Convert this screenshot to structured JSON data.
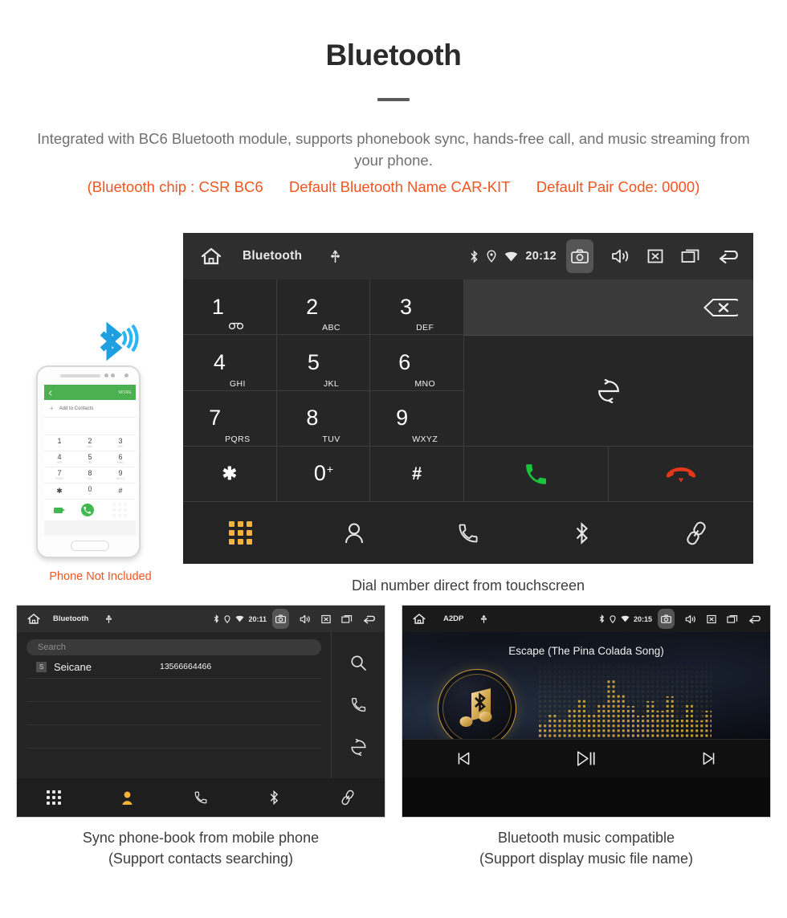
{
  "header": {
    "title": "Bluetooth",
    "description": "Integrated with BC6 Bluetooth module, supports phonebook sync, hands-free call, and music streaming from your phone.",
    "spec_chip": "(Bluetooth chip : CSR BC6",
    "spec_name": "Default Bluetooth Name CAR-KIT",
    "spec_pair": "Default Pair Code: 0000)",
    "accent_color": "#f4541f",
    "text_color": "#707070"
  },
  "phone_mockup": {
    "topbar_more": "MORE",
    "add_to_contacts": "Add to Contacts",
    "plus": "+",
    "keys": [
      {
        "num": "1",
        "sub": "∞"
      },
      {
        "num": "2",
        "sub": "ABC"
      },
      {
        "num": "3",
        "sub": "DEF"
      },
      {
        "num": "4",
        "sub": "GHI"
      },
      {
        "num": "5",
        "sub": "JKL"
      },
      {
        "num": "6",
        "sub": "MNO"
      },
      {
        "num": "7",
        "sub": "PQRS"
      },
      {
        "num": "8",
        "sub": "TUV"
      },
      {
        "num": "9",
        "sub": "WXYZ"
      },
      {
        "num": "✱",
        "sub": ""
      },
      {
        "num": "0",
        "sub": "+"
      },
      {
        "num": "#",
        "sub": ""
      }
    ],
    "not_included_note": "Phone Not Included",
    "note_color": "#f4541f",
    "bluetooth_logo_color": "#1e9fe0"
  },
  "dialer": {
    "statusbar": {
      "home_icon": "home-icon",
      "title": "Bluetooth",
      "usb_icon": "usb-icon",
      "bluetooth_icon": "bluetooth-icon",
      "location_icon": "location-icon",
      "wifi_icon": "wifi-icon",
      "time": "20:12",
      "camera_icon": "camera-icon",
      "volume_icon": "volume-icon",
      "mute_icon": "mute-box-icon",
      "recents_icon": "recents-icon",
      "back_icon": "back-icon"
    },
    "keys": [
      {
        "num": "1",
        "sub": "voicemail"
      },
      {
        "num": "2",
        "sub": "ABC"
      },
      {
        "num": "3",
        "sub": "DEF"
      },
      {
        "num": "4",
        "sub": "GHI"
      },
      {
        "num": "5",
        "sub": "JKL"
      },
      {
        "num": "6",
        "sub": "MNO"
      },
      {
        "num": "7",
        "sub": "PQRS"
      },
      {
        "num": "8",
        "sub": "TUV"
      },
      {
        "num": "9",
        "sub": "WXYZ"
      },
      {
        "num": "✱",
        "sub": ""
      },
      {
        "num": "0",
        "sub": "+"
      },
      {
        "num": "#",
        "sub": ""
      }
    ],
    "backspace_icon": "backspace-icon",
    "swap_icon": "sync-transfer-icon",
    "call_icon": "call-icon",
    "hangup_icon": "hangup-icon",
    "call_color": "#17c43a",
    "hangup_color": "#e8361a",
    "navbar": [
      {
        "icon": "keypad-icon",
        "active": true
      },
      {
        "icon": "contacts-icon",
        "active": false
      },
      {
        "icon": "call-log-icon",
        "active": false
      },
      {
        "icon": "bluetooth-icon",
        "active": false
      },
      {
        "icon": "link-icon",
        "active": false
      }
    ],
    "active_color": "#f5b33c",
    "caption": "Dial number direct from touchscreen"
  },
  "phonebook": {
    "statusbar": {
      "title": "Bluetooth",
      "time": "20:11"
    },
    "search_placeholder": "Search",
    "columns": [
      "name",
      "number"
    ],
    "contacts": [
      {
        "badge": "S",
        "name": "Seicane",
        "number": "13566664466"
      }
    ],
    "sidebar": [
      {
        "icon": "search-icon"
      },
      {
        "icon": "call-icon"
      },
      {
        "icon": "sync-icon"
      }
    ],
    "navbar": [
      {
        "icon": "keypad-icon",
        "active": false
      },
      {
        "icon": "contacts-icon",
        "active": true
      },
      {
        "icon": "call-log-icon",
        "active": false
      },
      {
        "icon": "bluetooth-icon",
        "active": false
      },
      {
        "icon": "link-icon",
        "active": false
      }
    ],
    "caption_line1": "Sync phone-book from mobile phone",
    "caption_line2": "(Support contacts searching)"
  },
  "music": {
    "statusbar": {
      "title": "A2DP",
      "time": "20:15"
    },
    "track_title": "Escape (The Pina Colada Song)",
    "album_icon": "music-note-bluetooth-icon",
    "controls": [
      {
        "icon": "previous-icon"
      },
      {
        "icon": "play-pause-icon"
      },
      {
        "icon": "next-icon"
      }
    ],
    "accent_color": "#c79a3a",
    "caption_line1": "Bluetooth music compatible",
    "caption_line2": "(Support display music file name)"
  }
}
